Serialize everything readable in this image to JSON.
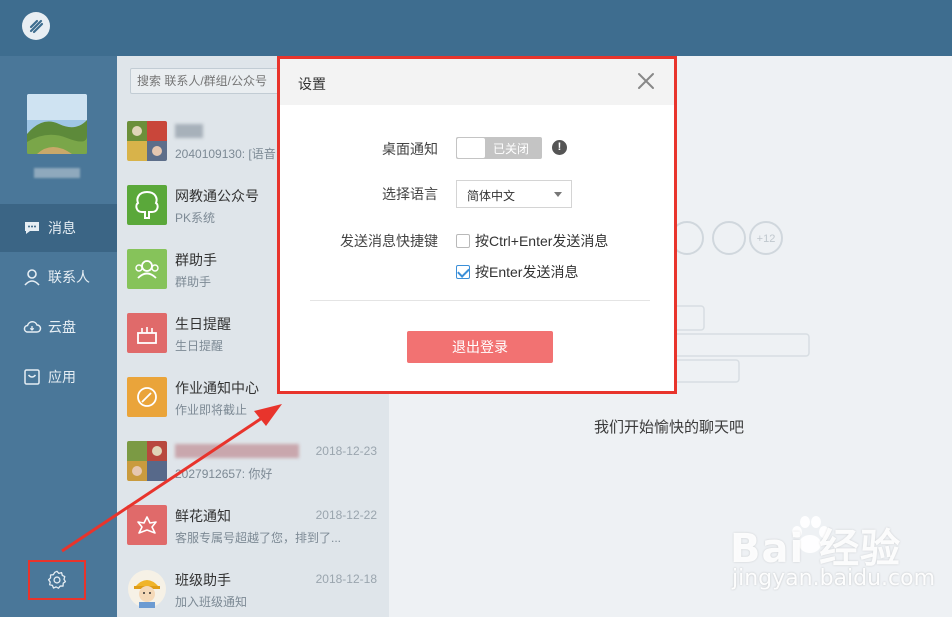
{
  "search": {
    "placeholder": "搜索 联系人/群组/公众号"
  },
  "nav": {
    "items": [
      {
        "label": "消息",
        "icon": "chat-bubble-icon",
        "active": true
      },
      {
        "label": "联系人",
        "icon": "contact-icon",
        "active": false
      },
      {
        "label": "云盘",
        "icon": "cloud-drive-icon",
        "active": false
      },
      {
        "label": "应用",
        "icon": "apps-icon",
        "active": false
      }
    ],
    "settings_icon": "gear-icon"
  },
  "conversations": [
    {
      "name": "",
      "preview": "2040109130: [语音",
      "date": "",
      "avatar": "photo-grid"
    },
    {
      "name": "网教通公众号",
      "preview": "PK系统",
      "date": "",
      "avatar": "green-tree"
    },
    {
      "name": "群助手",
      "preview": "群助手",
      "date": "",
      "avatar": "light-green-group"
    },
    {
      "name": "生日提醒",
      "preview": "生日提醒",
      "date": "",
      "avatar": "red-cake"
    },
    {
      "name": "作业通知中心",
      "preview": "作业即将截止",
      "date": "",
      "avatar": "orange-leaf"
    },
    {
      "name": "",
      "preview": "2027912657: 你好",
      "date": "2018-12-23",
      "avatar": "photo-grid"
    },
    {
      "name": "鲜花通知",
      "preview": "客服专属号超越了您，排到了...",
      "date": "2018-12-22",
      "avatar": "red-flower"
    },
    {
      "name": "班级助手",
      "preview": "加入班级通知",
      "date": "2018-12-18",
      "avatar": "worker"
    }
  ],
  "main": {
    "empty_text": "我们开始愉快的聊天吧",
    "badge_count": "+12"
  },
  "dialog": {
    "title": "设置",
    "desktop_notify_label": "桌面通知",
    "toggle_state": "已关闭",
    "info_mark": "!",
    "language_label": "选择语言",
    "language_value": "简体中文",
    "shortcut_label": "发送消息快捷键",
    "option_ctrl_enter": "按Ctrl+Enter发送消息",
    "option_enter": "按Enter发送消息",
    "option_ctrl_enter_checked": false,
    "option_enter_checked": true,
    "logout_label": "退出登录"
  },
  "watermark": {
    "brand": "Bai  经验",
    "url": "jingyan.baidu.com"
  },
  "colors": {
    "header": "#3e6d8f",
    "nav": "#4a7799",
    "accent_red": "#e8342c",
    "logout": "#f27272"
  }
}
